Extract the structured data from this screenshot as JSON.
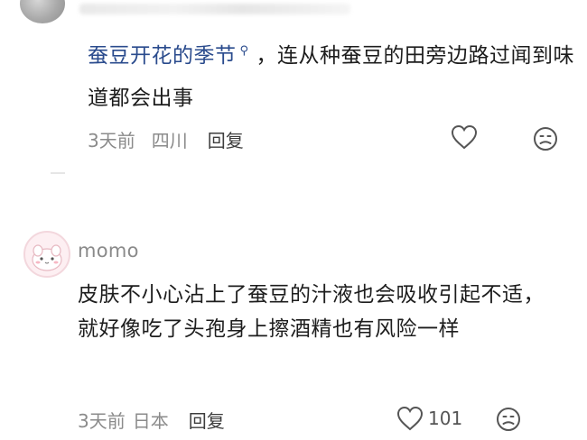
{
  "comment1": {
    "topic_text": "蚕豆开花的季节",
    "text_after_topic": "，连从种蚕豆的田旁边路过闻到味道都会出事",
    "time": "3天前",
    "location": "四川",
    "reply_label": "回复"
  },
  "comment2": {
    "username": "momo",
    "text": "皮肤不小心沾上了蚕豆的汁液也会吸收引起不适，就好像吃了头孢身上擦酒精也有风险一样",
    "time": "3天前",
    "location": "日本",
    "reply_label": "回复",
    "like_count": "101"
  },
  "icons": {
    "topic": "search-icon",
    "like": "heart-icon",
    "dislike": "sad-face-icon"
  }
}
